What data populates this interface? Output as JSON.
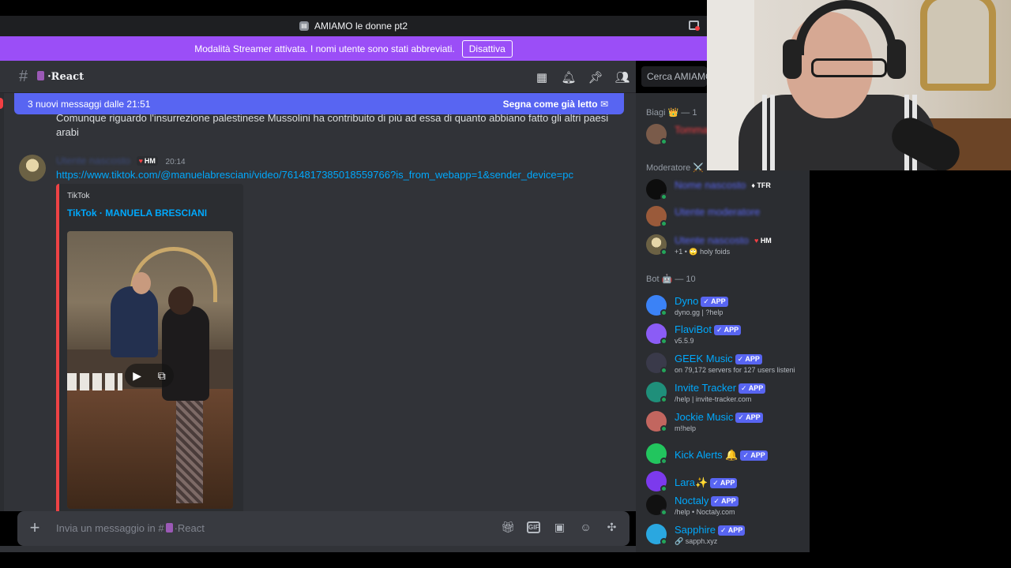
{
  "window": {
    "title": "AMIAMO le donne pt2"
  },
  "streamer_banner": {
    "text": "Modalità Streamer attivata. I nomi utente sono stati abbreviati.",
    "button": "Disattiva"
  },
  "channel": {
    "hash": "#",
    "name": "·React"
  },
  "header_icons": [
    "threads-icon",
    "bell-icon",
    "pin-icon",
    "members-icon"
  ],
  "search": {
    "placeholder": "Cerca AMIAMO"
  },
  "new_messages_bar": {
    "text": "3 nuovi messaggi dalle 21:51",
    "action": "Segna come già letto"
  },
  "messages": [
    {
      "text": "Comunque riguardo l'insurrezione palestinese Mussolini ha contribuito di più ad essa di quanto abbiano fatto gli altri paesi arabi"
    },
    {
      "tag": "HM",
      "time": "20:14",
      "link": "https://www.tiktok.com/@manuelabresciani/video/7614817385018559766?is_from_webapp=1&sender_device=pc",
      "embed": {
        "provider": "TikTok",
        "title": "TikTok · MANUELA BRESCIANI"
      }
    }
  ],
  "composer": {
    "placeholder_prefix": "Invia un messaggio in #",
    "placeholder_channel": "·React"
  },
  "members": {
    "sections": [
      {
        "label": "Biagi 👑 — 1"
      },
      {
        "label": "Moderatore ⚔️"
      },
      {
        "label": "Bot 🤖 — 10"
      }
    ],
    "owner": {
      "name": "Tommaso"
    },
    "moderators": [
      {
        "name": "Nome nascosto",
        "tag": "TFR"
      },
      {
        "name": "Utente moderatore"
      },
      {
        "name": "Utente nascosto",
        "tag": "HM",
        "status": "+1 • 🙄 holy foids"
      }
    ],
    "bots": [
      {
        "name": "Dyno",
        "badge": "✓ APP",
        "status": "dyno.gg | ?help",
        "color": "#3b82f6"
      },
      {
        "name": "FlaviBot",
        "badge": "✓ APP",
        "status": "v5.5.9",
        "color": "#8b5cf6"
      },
      {
        "name": "GEEK Music",
        "badge": "✓ APP",
        "status": "on 79,172 servers for 127 users listeni",
        "color": "#3a3a4a"
      },
      {
        "name": "Invite Tracker",
        "badge": "✓ APP",
        "status": "/help | invite-tracker.com",
        "color": "#1f8f7a"
      },
      {
        "name": "Jockie Music",
        "badge": "✓ APP",
        "status": "m!help",
        "color": "#c2665f"
      },
      {
        "name": "Kick Alerts 🔔",
        "badge": "✓ APP",
        "status": "",
        "color": "#22c55e"
      },
      {
        "name": "Lara✨",
        "badge": "✓ APP",
        "status": "",
        "color": "#7c3aed"
      },
      {
        "name": "Noctaly",
        "badge": "✓ APP",
        "status": "/help • Noctaly.com",
        "color": "#111111"
      },
      {
        "name": "Sapphire",
        "badge": "✓ APP",
        "status": "🔗 sapph.xyz",
        "color": "#2aa7e0"
      }
    ]
  },
  "colors": {
    "accent": "#5865f2",
    "streamer": "#9b4ef7",
    "link": "#00a8fc",
    "online": "#23a55a",
    "embed_border": "#ed4245"
  }
}
